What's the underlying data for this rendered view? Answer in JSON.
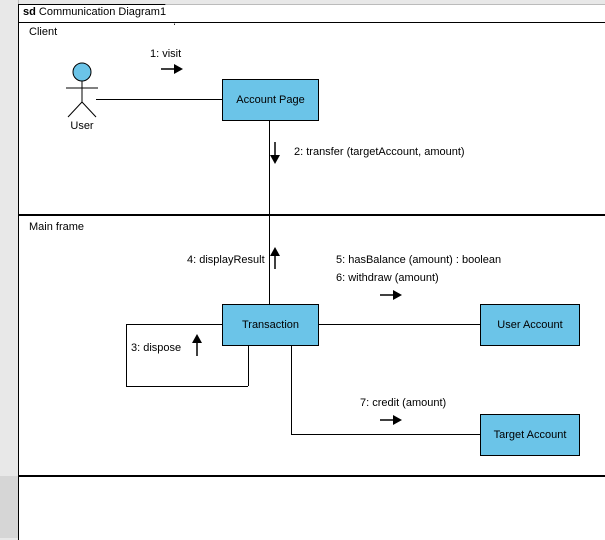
{
  "tab": {
    "prefix": "sd",
    "title": "Communication Diagram1"
  },
  "partitions": {
    "client": "Client",
    "mainframe": "Main frame"
  },
  "actor": {
    "name": "User"
  },
  "nodes": {
    "accountPage": "Account Page",
    "transaction": "Transaction",
    "userAccount": "User Account",
    "targetAccount": "Target Account"
  },
  "messages": {
    "m1": "1: visit",
    "m2": "2: transfer (targetAccount, amount)",
    "m3": "3: dispose",
    "m4": "4: displayResult",
    "m5": "5: hasBalance (amount) : boolean",
    "m6": "6: withdraw (amount)",
    "m7": "7: credit (amount)"
  },
  "chart_data": {
    "type": "communication-diagram",
    "title": "Communication Diagram1",
    "partitions": [
      "Client",
      "Main frame"
    ],
    "lifelines": [
      {
        "id": "user",
        "name": "User",
        "kind": "actor",
        "partition": "Client"
      },
      {
        "id": "accountPage",
        "name": "Account Page",
        "kind": "object",
        "partition": "Client"
      },
      {
        "id": "transaction",
        "name": "Transaction",
        "kind": "object",
        "partition": "Main frame"
      },
      {
        "id": "userAccount",
        "name": "User Account",
        "kind": "object",
        "partition": "Main frame"
      },
      {
        "id": "targetAccount",
        "name": "Target Account",
        "kind": "object",
        "partition": "Main frame"
      }
    ],
    "messages": [
      {
        "seq": 1,
        "from": "user",
        "to": "accountPage",
        "label": "visit"
      },
      {
        "seq": 2,
        "from": "accountPage",
        "to": "transaction",
        "label": "transfer (targetAccount, amount)"
      },
      {
        "seq": 3,
        "from": "transaction",
        "to": "transaction",
        "label": "dispose"
      },
      {
        "seq": 4,
        "from": "transaction",
        "to": "accountPage",
        "label": "displayResult"
      },
      {
        "seq": 5,
        "from": "transaction",
        "to": "userAccount",
        "label": "hasBalance (amount) : boolean"
      },
      {
        "seq": 6,
        "from": "transaction",
        "to": "userAccount",
        "label": "withdraw (amount)"
      },
      {
        "seq": 7,
        "from": "transaction",
        "to": "targetAccount",
        "label": "credit (amount)"
      }
    ]
  }
}
